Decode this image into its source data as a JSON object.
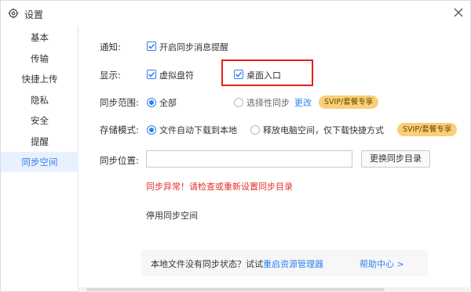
{
  "window": {
    "title": "设置"
  },
  "sidebar": {
    "items": [
      {
        "label": "基本"
      },
      {
        "label": "传输"
      },
      {
        "label": "快捷上传"
      },
      {
        "label": "隐私"
      },
      {
        "label": "安全"
      },
      {
        "label": "提醒"
      },
      {
        "label": "同步空间",
        "active": true
      }
    ]
  },
  "notify": {
    "label": "通知:",
    "option": "开启同步消息提醒",
    "checked": true
  },
  "display": {
    "label": "显示:",
    "virtual_drive": "虚拟盘符",
    "virtual_drive_checked": true,
    "desktop_entry": "桌面入口",
    "desktop_entry_checked": true
  },
  "sync_scope": {
    "label": "同步范围:",
    "all": "全部",
    "selective": "选择性同步",
    "change_link": "更改",
    "badge": "SVIP/套餐专享",
    "selected": "all"
  },
  "storage_mode": {
    "label": "存储模式:",
    "auto_download": "文件自动下载到本地",
    "free_space": "释放电脑空间，仅下载快捷方式",
    "badge": "SVIP/套餐专享",
    "selected": "auto_download"
  },
  "sync_location": {
    "label": "同步位置:",
    "value": "",
    "change_button": "更换同步目录",
    "error": "同步异常！请检查或重新设置同步目录",
    "disable_link": "停用同步空间"
  },
  "tip": {
    "text": "本地文件没有同步状态？试试",
    "restart_link": "重启资源管理器",
    "help_link": "帮助中心 >"
  },
  "colors": {
    "accent": "#2e80f0",
    "error": "#e2312d",
    "badge_bg": "#f9cf77",
    "highlight": "#e0201c"
  }
}
